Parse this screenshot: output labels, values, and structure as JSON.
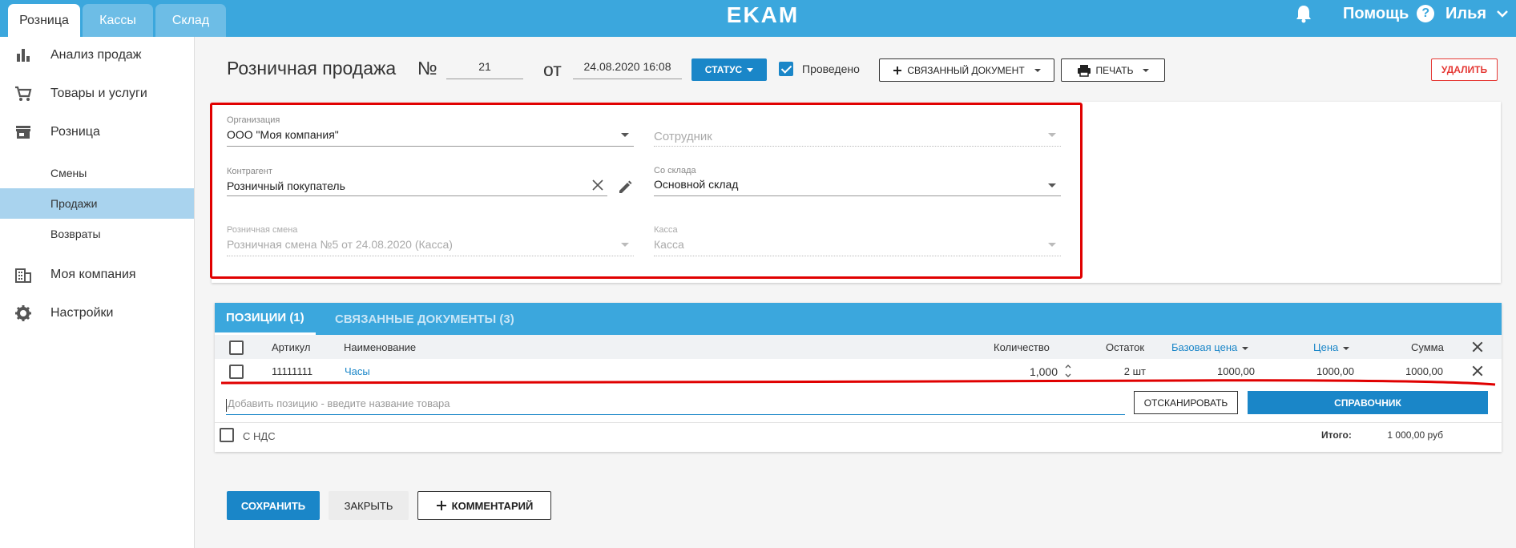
{
  "topbar": {
    "tabs": [
      "Розница",
      "Кассы",
      "Склад"
    ],
    "logo": "EKAM",
    "help": "Помощь",
    "help_glyph": "?",
    "user": "Илья"
  },
  "sidebar": {
    "items": [
      {
        "label": "Анализ продаж",
        "icon": "bar-chart-icon"
      },
      {
        "label": "Товары и услуги",
        "icon": "cart-icon"
      },
      {
        "label": "Розница",
        "icon": "store-icon"
      },
      {
        "label": "Моя компания",
        "icon": "building-icon"
      },
      {
        "label": "Настройки",
        "icon": "gear-icon"
      }
    ],
    "subitems": [
      "Смены",
      "Продажи",
      "Возвраты"
    ],
    "active_subitem": "Продажи"
  },
  "header": {
    "title": "Розничная продажа",
    "number_sign": "№",
    "number": "21",
    "from_label": "от",
    "date": "24.08.2020 16:08",
    "status_label": "СТАТУС",
    "posted_label": "Проведено",
    "posted_checked": true,
    "related_doc_label": "СВЯЗАННЫЙ ДОКУМЕНТ",
    "print_label": "ПЕЧАТЬ",
    "delete_label": "УДАЛИТЬ"
  },
  "form": {
    "organization": {
      "label": "Организация",
      "value": "ООО \"Моя компания\""
    },
    "employee": {
      "placeholder": "Сотрудник"
    },
    "counterparty": {
      "label": "Контрагент",
      "value": "Розничный покупатель"
    },
    "warehouse": {
      "label": "Со склада",
      "value": "Основной склад"
    },
    "shift": {
      "label": "Розничная смена",
      "value": "Розничная смена №5 от 24.08.2020 (Касса)"
    },
    "cashbox": {
      "label": "Касса",
      "value": "Касса"
    }
  },
  "positions": {
    "tabs": [
      "ПОЗИЦИИ (1)",
      "СВЯЗАННЫЕ ДОКУМЕНТЫ (3)"
    ],
    "columns": {
      "article": "Артикул",
      "name": "Наименование",
      "quantity": "Количество",
      "stock": "Остаток",
      "base_price": "Базовая цена",
      "price": "Цена",
      "sum": "Сумма"
    },
    "rows": [
      {
        "article": "11111111",
        "name": "Часы",
        "quantity": "1,000",
        "stock": "2 шт",
        "base_price": "1000,00",
        "price": "1000,00",
        "sum": "1000,00"
      }
    ],
    "add_placeholder": "Добавить позицию - введите название товара",
    "scan_label": "ОТСКАНИРОВАТЬ",
    "reference_label": "СПРАВОЧНИК",
    "vat_label": "С НДС",
    "total_label": "Итого:",
    "total_value": "1 000,00 руб"
  },
  "footer": {
    "save_label": "СОХРАНИТЬ",
    "close_label": "ЗАКРЫТЬ",
    "comment_label": "КОММЕНТАРИЙ"
  },
  "colors": {
    "primary": "#3ba7dd",
    "button": "#1a86c8",
    "highlight": "#e00000",
    "danger": "#e53935"
  }
}
